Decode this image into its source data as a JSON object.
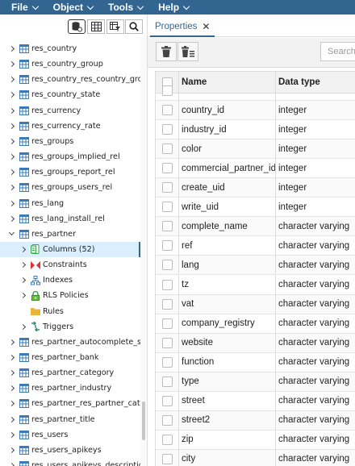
{
  "menubar": {
    "items": [
      {
        "label": "File"
      },
      {
        "label": "Object"
      },
      {
        "label": "Tools"
      },
      {
        "label": "Help"
      }
    ]
  },
  "tree": {
    "items": [
      {
        "label": "res_country",
        "kind": "table",
        "depth": 0,
        "expanded": false
      },
      {
        "label": "res_country_group",
        "kind": "table",
        "depth": 0,
        "expanded": false
      },
      {
        "label": "res_country_res_country_group_rel",
        "kind": "table",
        "depth": 0,
        "expanded": false
      },
      {
        "label": "res_country_state",
        "kind": "table",
        "depth": 0,
        "expanded": false
      },
      {
        "label": "res_currency",
        "kind": "table",
        "depth": 0,
        "expanded": false
      },
      {
        "label": "res_currency_rate",
        "kind": "table",
        "depth": 0,
        "expanded": false
      },
      {
        "label": "res_groups",
        "kind": "table",
        "depth": 0,
        "expanded": false
      },
      {
        "label": "res_groups_implied_rel",
        "kind": "table",
        "depth": 0,
        "expanded": false
      },
      {
        "label": "res_groups_report_rel",
        "kind": "table",
        "depth": 0,
        "expanded": false
      },
      {
        "label": "res_groups_users_rel",
        "kind": "table",
        "depth": 0,
        "expanded": false
      },
      {
        "label": "res_lang",
        "kind": "table",
        "depth": 0,
        "expanded": false
      },
      {
        "label": "res_lang_install_rel",
        "kind": "table",
        "depth": 0,
        "expanded": false
      },
      {
        "label": "res_partner",
        "kind": "table",
        "depth": 0,
        "expanded": true
      },
      {
        "label": "Columns (52)",
        "kind": "columns",
        "depth": 1,
        "expanded": false,
        "selected": true
      },
      {
        "label": "Constraints",
        "kind": "constraints",
        "depth": 1,
        "expanded": false
      },
      {
        "label": "Indexes",
        "kind": "indexes",
        "depth": 1,
        "expanded": false
      },
      {
        "label": "RLS Policies",
        "kind": "rls",
        "depth": 1,
        "expanded": false
      },
      {
        "label": "Rules",
        "kind": "rules",
        "depth": 1,
        "expanded": null
      },
      {
        "label": "Triggers",
        "kind": "triggers",
        "depth": 1,
        "expanded": false
      },
      {
        "label": "res_partner_autocomplete_sync",
        "kind": "table",
        "depth": 0,
        "expanded": false
      },
      {
        "label": "res_partner_bank",
        "kind": "table",
        "depth": 0,
        "expanded": false
      },
      {
        "label": "res_partner_category",
        "kind": "table",
        "depth": 0,
        "expanded": false
      },
      {
        "label": "res_partner_industry",
        "kind": "table",
        "depth": 0,
        "expanded": false
      },
      {
        "label": "res_partner_res_partner_category_rel",
        "kind": "table",
        "depth": 0,
        "expanded": false
      },
      {
        "label": "res_partner_title",
        "kind": "table",
        "depth": 0,
        "expanded": false
      },
      {
        "label": "res_users",
        "kind": "table",
        "depth": 0,
        "expanded": false
      },
      {
        "label": "res_users_apikeys",
        "kind": "table",
        "depth": 0,
        "expanded": false
      },
      {
        "label": "res_users_apikeys_description",
        "kind": "table",
        "depth": 0,
        "expanded": false
      }
    ]
  },
  "tabs": [
    {
      "label": "Properties",
      "close": "✕"
    }
  ],
  "search": {
    "placeholder": "Search"
  },
  "grid": {
    "headers": {
      "name": "Name",
      "type": "Data type"
    },
    "rows": [
      {
        "name": "",
        "type": ""
      },
      {
        "name": "country_id",
        "type": "integer"
      },
      {
        "name": "industry_id",
        "type": "integer"
      },
      {
        "name": "color",
        "type": "integer"
      },
      {
        "name": "commercial_partner_id",
        "type": "integer"
      },
      {
        "name": "create_uid",
        "type": "integer"
      },
      {
        "name": "write_uid",
        "type": "integer"
      },
      {
        "name": "complete_name",
        "type": "character varying"
      },
      {
        "name": "ref",
        "type": "character varying"
      },
      {
        "name": "lang",
        "type": "character varying"
      },
      {
        "name": "tz",
        "type": "character varying"
      },
      {
        "name": "vat",
        "type": "character varying"
      },
      {
        "name": "company_registry",
        "type": "character varying"
      },
      {
        "name": "website",
        "type": "character varying"
      },
      {
        "name": "function",
        "type": "character varying"
      },
      {
        "name": "type",
        "type": "character varying"
      },
      {
        "name": "street",
        "type": "character varying"
      },
      {
        "name": "street2",
        "type": "character varying"
      },
      {
        "name": "zip",
        "type": "character varying"
      },
      {
        "name": "city",
        "type": "character varying"
      }
    ]
  },
  "colors": {
    "accent": "#326690",
    "selected_row": "#daeefd"
  }
}
